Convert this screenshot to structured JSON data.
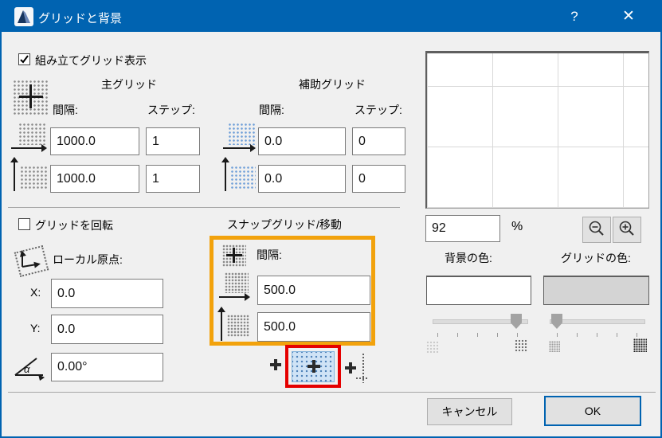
{
  "window": {
    "title": "グリッドと背景",
    "help_label": "?",
    "close_label": "✕"
  },
  "construction_grid": {
    "display_checkbox_label": "組み立てグリッド表示",
    "display_checked": true
  },
  "main_grid": {
    "title": "主グリッド",
    "spacing_label": "間隔:",
    "step_label": "ステップ:",
    "horizontal": {
      "spacing": "1000.0",
      "step": "1"
    },
    "vertical": {
      "spacing": "1000.0",
      "step": "1"
    }
  },
  "aux_grid": {
    "title": "補助グリッド",
    "spacing_label": "間隔:",
    "step_label": "ステップ:",
    "horizontal": {
      "spacing": "0.0",
      "step": "0"
    },
    "vertical": {
      "spacing": "0.0",
      "step": "0"
    }
  },
  "rotate_section": {
    "rotate_checkbox_label": "グリッドを回転",
    "rotate_checked": false,
    "local_origin_label": "ローカル原点:",
    "x_label": "X:",
    "x_value": "0.0",
    "y_label": "Y:",
    "y_value": "0.0",
    "angle_value": "0.00°"
  },
  "snap_grid": {
    "title": "スナップグリッド/移動",
    "spacing_label": "間隔:",
    "horizontal_spacing": "500.0",
    "vertical_spacing": "500.0",
    "selected_mode": "snap-grid-active"
  },
  "preview": {
    "zoom_value": "92",
    "percent_label": "%"
  },
  "color_settings": {
    "background_label": "背景の色:",
    "grid_label": "グリッドの色:",
    "background_color": "#FFFFFF",
    "grid_color": "#D4D4D4"
  },
  "footer": {
    "cancel_label": "キャンセル",
    "ok_label": "OK"
  },
  "annotations": {
    "orange_box_color": "#F2A20C",
    "red_box_color": "#E50000"
  },
  "accent": {
    "titlebar_color": "#0063B1"
  }
}
